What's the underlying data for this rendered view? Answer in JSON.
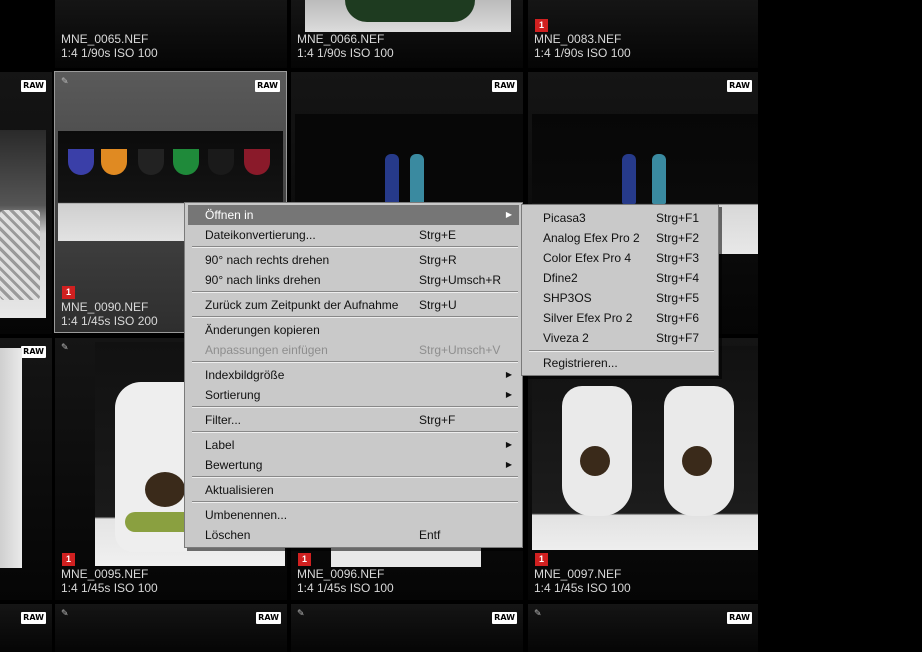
{
  "thumbnails": [
    {
      "id": "r0c1",
      "name": "MNE_0065.NEF",
      "info": "1:4 1/90s ISO 100",
      "flag": "",
      "raw": ""
    },
    {
      "id": "r0c2",
      "name": "MNE_0066.NEF",
      "info": "1:4 1/90s ISO 100",
      "flag": "",
      "raw": ""
    },
    {
      "id": "r0c3",
      "name": "MNE_0083.NEF",
      "info": "1:4 1/90s ISO 100",
      "flag": "1",
      "raw": ""
    },
    {
      "id": "r1c1",
      "name": "MNE_0090.NEF",
      "info": "1:4 1/45s ISO 200",
      "flag": "1",
      "raw": "RAW"
    },
    {
      "id": "r1c2",
      "name": "",
      "info": "",
      "flag": "",
      "raw": "RAW"
    },
    {
      "id": "r1c3",
      "name": "",
      "info": "",
      "flag": "",
      "raw": "RAW"
    },
    {
      "id": "r2c1",
      "name": "MNE_0095.NEF",
      "info": "1:4 1/45s ISO 100",
      "flag": "1",
      "raw": "RAW"
    },
    {
      "id": "r2c2",
      "name": "MNE_0096.NEF",
      "info": "1:4 1/45s ISO 100",
      "flag": "1",
      "raw": "RAW"
    },
    {
      "id": "r2c3",
      "name": "MNE_0097.NEF",
      "info": "1:4 1/45s ISO 100",
      "flag": "1",
      "raw": "RAW"
    }
  ],
  "raw_badge": "RAW",
  "context_menu": {
    "items": [
      {
        "label": "Öffnen in",
        "shortcut": "",
        "submenu": true,
        "highlighted": true,
        "disabled": false
      },
      {
        "label": "Dateikonvertierung...",
        "shortcut": "Strg+E"
      },
      {
        "label": "90° nach rechts drehen",
        "shortcut": "Strg+R"
      },
      {
        "label": "90° nach links drehen",
        "shortcut": "Strg+Umsch+R"
      },
      {
        "label": "Zurück zum Zeitpunkt der Aufnahme",
        "shortcut": "Strg+U"
      },
      {
        "label": "Änderungen kopieren",
        "shortcut": ""
      },
      {
        "label": "Anpassungen einfügen",
        "shortcut": "Strg+Umsch+V",
        "disabled": true
      },
      {
        "label": "Indexbildgröße",
        "shortcut": "",
        "submenu": true
      },
      {
        "label": "Sortierung",
        "shortcut": "",
        "submenu": true
      },
      {
        "label": "Filter...",
        "shortcut": "Strg+F"
      },
      {
        "label": "Label",
        "shortcut": "",
        "submenu": true
      },
      {
        "label": "Bewertung",
        "shortcut": "",
        "submenu": true
      },
      {
        "label": "Aktualisieren",
        "shortcut": ""
      },
      {
        "label": "Umbenennen...",
        "shortcut": ""
      },
      {
        "label": "Löschen",
        "shortcut": "Entf"
      }
    ]
  },
  "open_with_submenu": {
    "items": [
      {
        "label": "Picasa3",
        "shortcut": "Strg+F1"
      },
      {
        "label": "Analog Efex Pro 2",
        "shortcut": "Strg+F2"
      },
      {
        "label": "Color Efex Pro 4",
        "shortcut": "Strg+F3"
      },
      {
        "label": "Dfine2",
        "shortcut": "Strg+F4"
      },
      {
        "label": "SHP3OS",
        "shortcut": "Strg+F5"
      },
      {
        "label": "Silver Efex Pro 2",
        "shortcut": "Strg+F6"
      },
      {
        "label": "Viveza 2",
        "shortcut": "Strg+F7"
      },
      {
        "label": "Registrieren...",
        "shortcut": ""
      }
    ]
  },
  "colors": {
    "menu_bg": "#c9c9c9",
    "menu_highlight": "#767676",
    "flag_red": "#d02020"
  }
}
